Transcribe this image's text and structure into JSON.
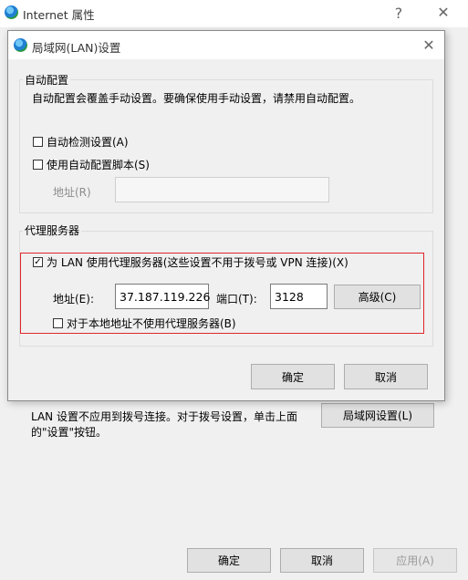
{
  "outer_window": {
    "title": "Internet 属性",
    "help_glyph": "?",
    "close_glyph": "✕",
    "lan_note": "LAN 设置不应用到拨号连接。对于拨号设置，单击上面的\"设置\"按钮。",
    "lan_settings_button": "局域网设置(L)",
    "ok_button": "确定",
    "cancel_button": "取消",
    "apply_button": "应用(A)"
  },
  "lan_dialog": {
    "title": "局域网(LAN)设置",
    "close_glyph": "✕",
    "auto_config": {
      "group_title": "自动配置",
      "description": "自动配置会覆盖手动设置。要确保使用手动设置，请禁用自动配置。",
      "auto_detect_label": "自动检测设置(A)",
      "auto_detect_checked": false,
      "use_script_label": "使用自动配置脚本(S)",
      "use_script_checked": false,
      "address_label": "地址(R)",
      "address_value": ""
    },
    "proxy": {
      "group_title": "代理服务器",
      "use_proxy_label": "为 LAN 使用代理服务器(这些设置不用于拨号或 VPN 连接)(X)",
      "use_proxy_checked": true,
      "check_glyph": "✓",
      "address_label": "地址(E):",
      "address_value": "37.187.119.226",
      "port_label": "端口(T):",
      "port_value": "3128",
      "advanced_button": "高级(C)",
      "bypass_local_label": "对于本地地址不使用代理服务器(B)",
      "bypass_local_checked": false
    },
    "ok_button": "确定",
    "cancel_button": "取消"
  },
  "colors": {
    "highlight_border": "#e0262b",
    "dialog_background": "#f0f0f0"
  }
}
